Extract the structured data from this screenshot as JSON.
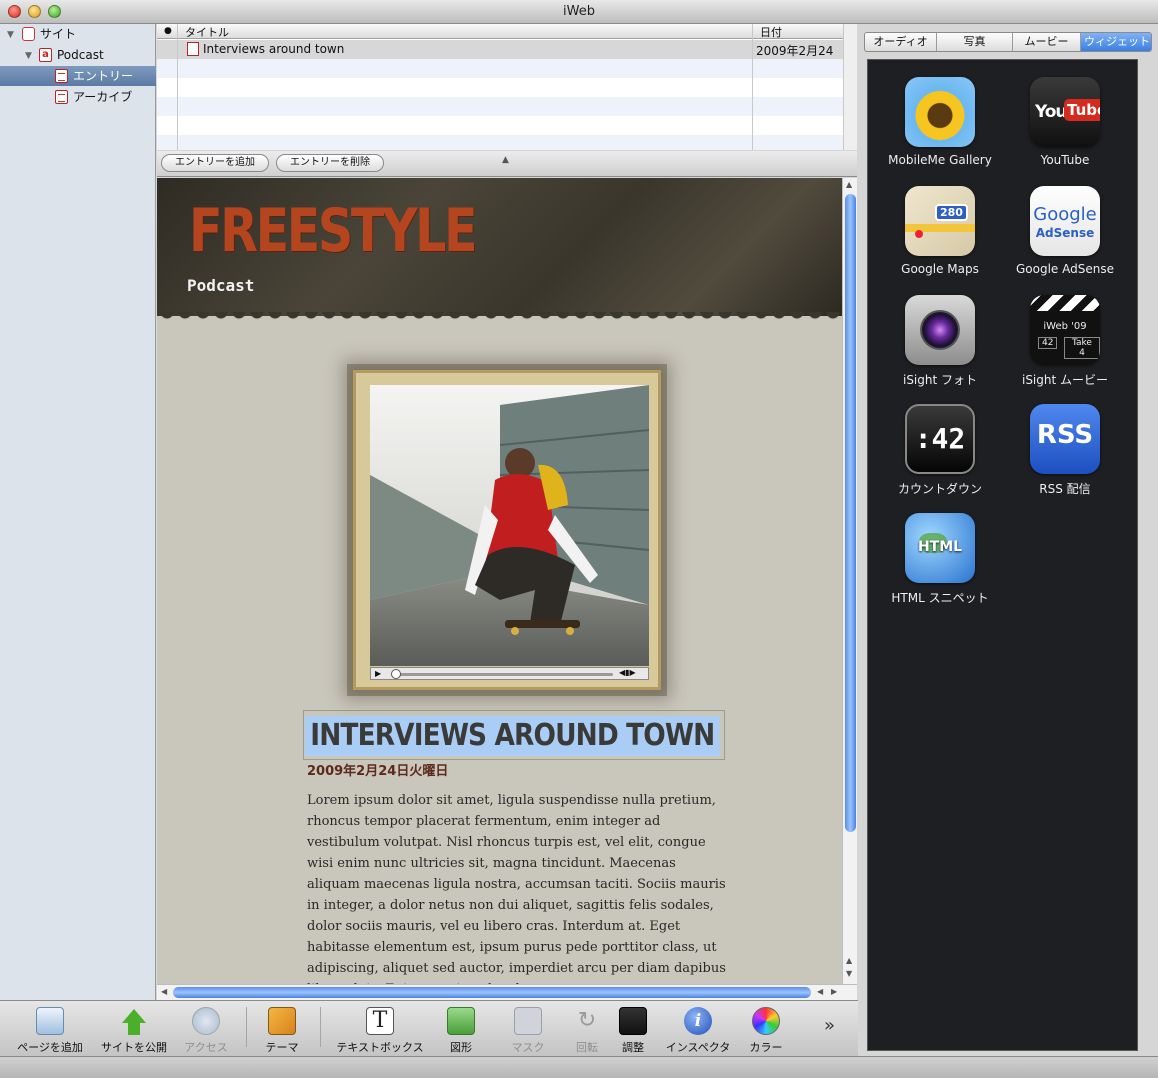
{
  "window": {
    "title": "iWeb"
  },
  "sidebar": {
    "items": [
      {
        "label": "サイト"
      },
      {
        "label": "Podcast"
      },
      {
        "label": "エントリー"
      },
      {
        "label": "アーカイブ"
      }
    ]
  },
  "entry_list": {
    "columns": {
      "title": "タイトル",
      "date": "日付"
    },
    "rows": [
      {
        "title": "Interviews around town",
        "date": "2009年2月24"
      }
    ]
  },
  "actions": {
    "add_entry": "エントリーを追加",
    "delete_entry": "エントリーを削除"
  },
  "page": {
    "site_title": "FREESTYLE",
    "subtitle": "Podcast",
    "entry_title": "INTERVIEWS AROUND TOWN",
    "entry_date": "2009年2月24日火曜日",
    "body": "Lorem ipsum dolor sit amet, ligula suspendisse nulla pretium, rhoncus tempor placerat fermentum, enim integer ad vestibulum volutpat. Nisl rhoncus turpis est, vel elit, congue wisi enim nunc ultricies sit, magna tincidunt. Maecenas aliquam maecenas ligula nostra, accumsan taciti. Sociis mauris in integer, a dolor netus non dui aliquet, sagittis felis sodales, dolor sociis mauris, vel eu libero cras. Interdum at. Eget habitasse elementum est, ipsum purus pede porttitor class, ut adipiscing, aliquet sed auctor, imperdiet arcu per diam dapibus libero duis. Enim eros in vel, volutpat nec"
  },
  "toolbar": {
    "add_page": "ページを追加",
    "publish": "サイトを公開",
    "visit": "アクセス",
    "theme": "テーマ",
    "textbox": "テキストボックス",
    "shapes": "図形",
    "mask": "マスク",
    "rotate": "回転",
    "adjust": "調整",
    "inspector": "インスペクタ",
    "colors": "カラー"
  },
  "media_tabs": [
    {
      "label": "オーディオ"
    },
    {
      "label": "写真"
    },
    {
      "label": "ムービー"
    },
    {
      "label": "ウィジェット",
      "active": true
    }
  ],
  "widgets": [
    {
      "label": "MobileMe Gallery",
      "icon": "sunflower-icon"
    },
    {
      "label": "YouTube",
      "icon": "youtube-icon",
      "icon_text_a": "You",
      "icon_text_b": "Tube"
    },
    {
      "label": "Google Maps",
      "icon": "map-icon",
      "icon_text": "280"
    },
    {
      "label": "Google AdSense",
      "icon": "adsense-icon",
      "icon_text_a": "Google",
      "icon_text_b": "AdSense"
    },
    {
      "label": "iSight フォト",
      "icon": "camera-icon"
    },
    {
      "label": "iSight ムービー",
      "icon": "clapper-icon",
      "icon_text_a": "iWeb '09",
      "icon_text_b": "42",
      "icon_text_c": "Take 4"
    },
    {
      "label": "カウントダウン",
      "icon": "countdown-icon",
      "icon_text": ":42"
    },
    {
      "label": "RSS 配信",
      "icon": "rss-icon",
      "icon_text": "RSS"
    },
    {
      "label": "HTML スニペット",
      "icon": "html-globe-icon",
      "icon_text": "HTML"
    }
  ],
  "colors": {
    "accent": "#3a7fe2",
    "site_title": "#b5451f",
    "selection": "#aacdf5"
  }
}
